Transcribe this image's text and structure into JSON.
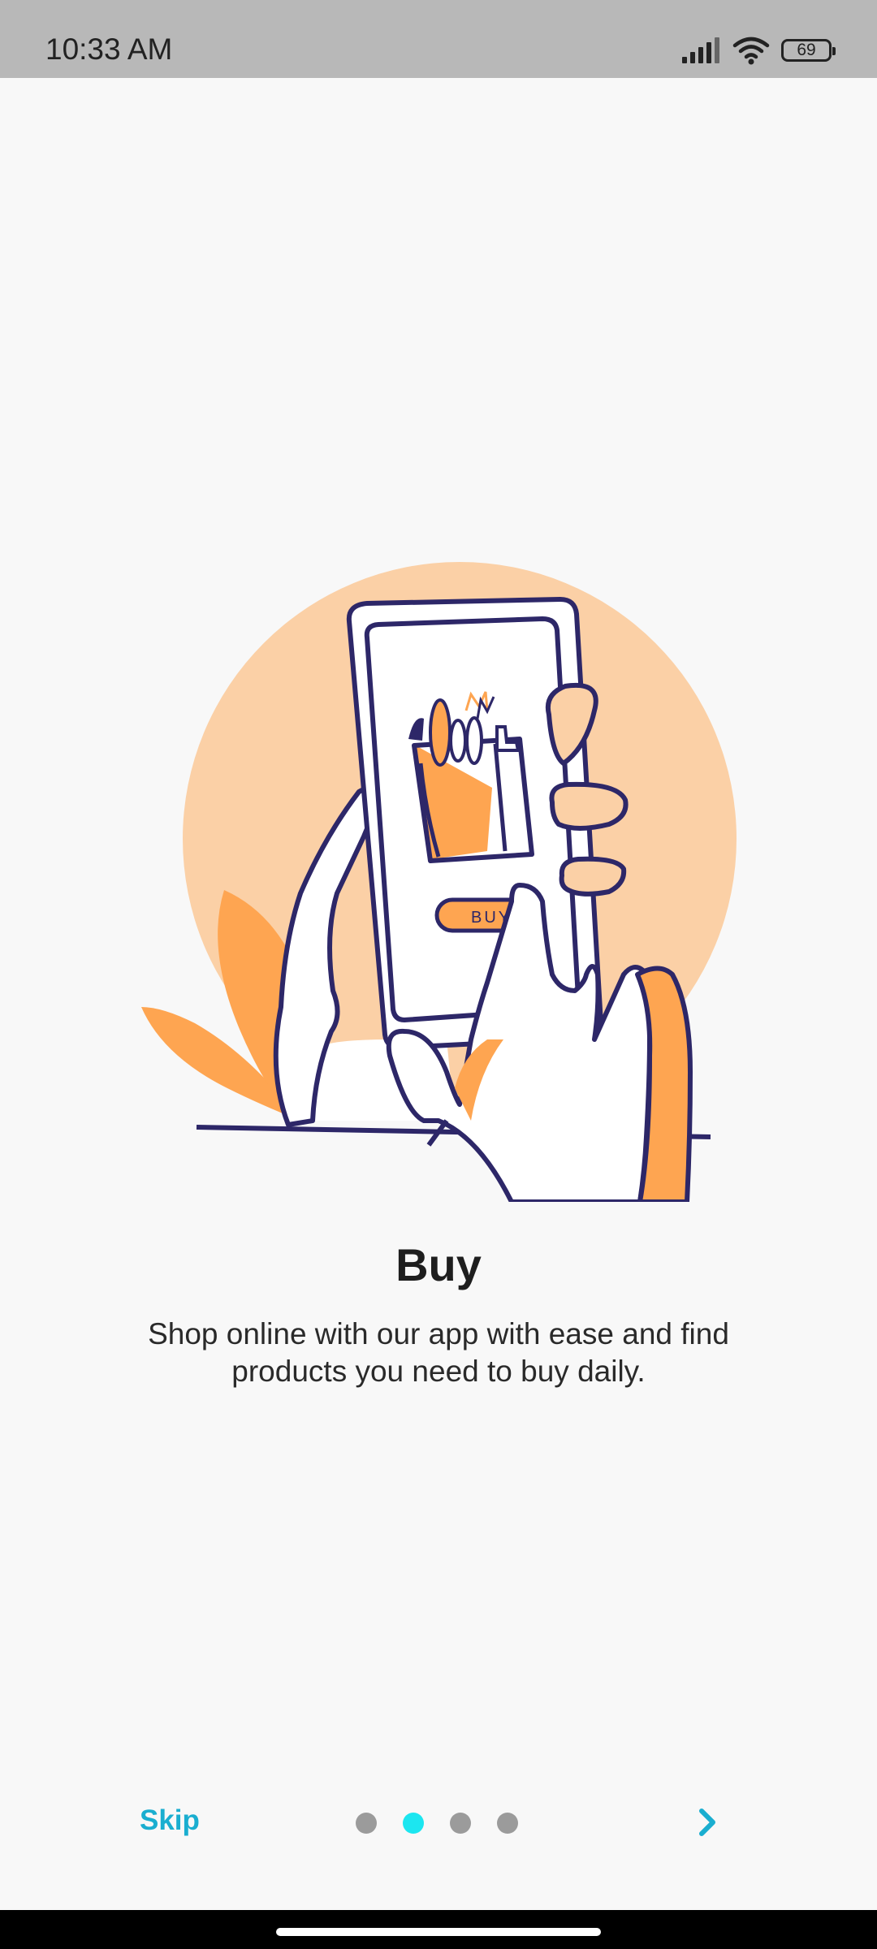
{
  "status_bar": {
    "time": "10:33 AM",
    "battery_level": "69",
    "icons": [
      "signal-icon",
      "wifi-icon",
      "battery-icon"
    ]
  },
  "onboarding": {
    "title": "Buy",
    "description": "Shop online with our app with ease and find products you need to buy daily.",
    "illustration": {
      "icon": "hand-holding-phone-illustration",
      "button_text": "BUY"
    }
  },
  "controls": {
    "skip_label": "Skip",
    "page_count": 4,
    "active_page": 2,
    "next_icon": "chevron-right-icon"
  },
  "colors": {
    "accent": "#1aaed0",
    "active_dot": "#1ce6f0",
    "inactive_dot": "#9b9b9b",
    "orange": "#fea551",
    "peach": "#fbd0a6",
    "outline": "#2d2768"
  }
}
